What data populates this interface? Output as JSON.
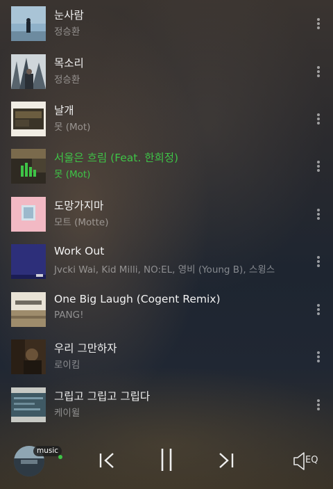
{
  "tracks": [
    {
      "title": "눈사람",
      "artist": "정승환",
      "active": false
    },
    {
      "title": "목소리",
      "artist": "정승환",
      "active": false
    },
    {
      "title": "날개",
      "artist": "못 (Mot)",
      "active": false
    },
    {
      "title": "서울은 흐림 (Feat. 한희정)",
      "artist": "못 (Mot)",
      "active": true
    },
    {
      "title": "도망가지마",
      "artist": "모트 (Motte)",
      "active": false
    },
    {
      "title": "Work Out",
      "artist": "Jvcki Wai, Kid Milli, NO:EL, 영비 (Young B), 스윙스",
      "active": false
    },
    {
      "title": "One Big Laugh (Cogent Remix)",
      "artist": "PANG!",
      "active": false
    },
    {
      "title": "우리 그만하자",
      "artist": "로이킴",
      "active": false
    },
    {
      "title": "그립고 그립고 그립다",
      "artist": "케이윌",
      "active": false
    }
  ],
  "player": {
    "badge_label": "music",
    "eq_label": "EQ",
    "accent_color": "#3ec447",
    "icons": [
      "skip-previous-icon",
      "pause-icon",
      "skip-next-icon",
      "speaker-eq-icon",
      "more-vertical-icon"
    ]
  }
}
